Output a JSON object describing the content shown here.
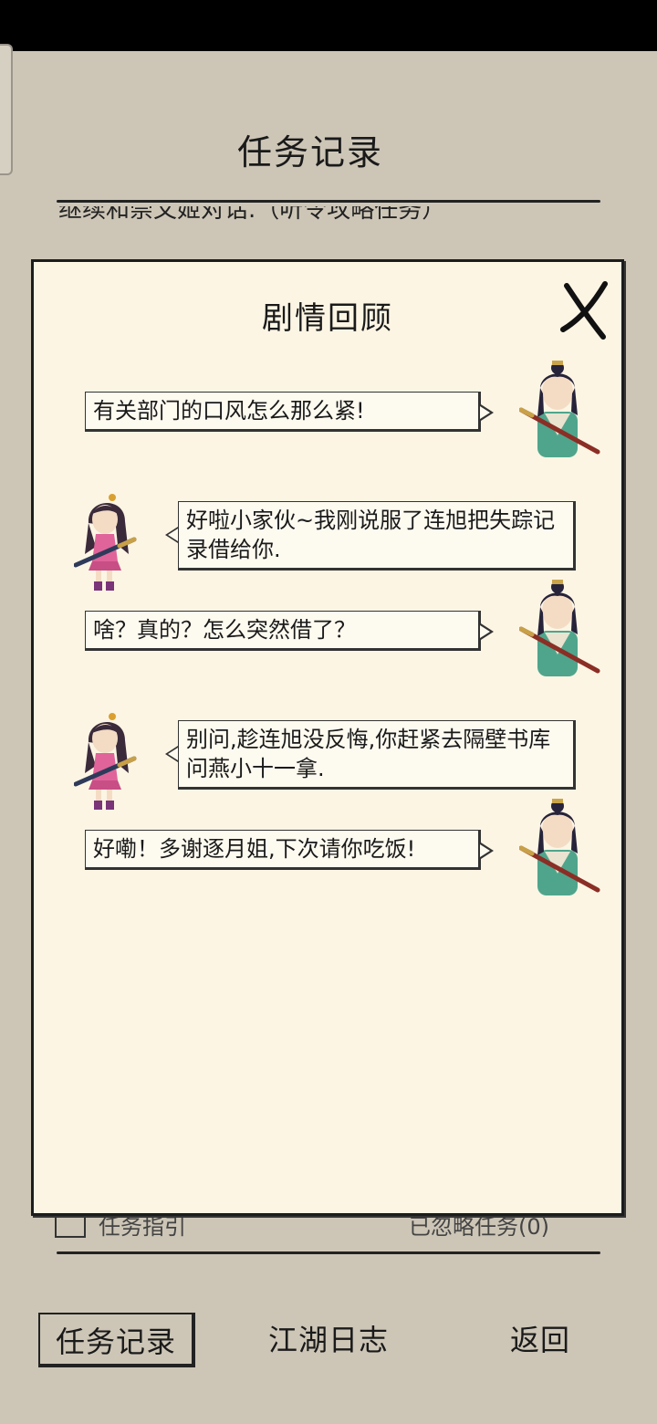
{
  "header": {
    "title": "任务记录"
  },
  "background_text": "继续和崇文姬对话.（听令攻略任务）",
  "dialog": {
    "title": "剧情回顾",
    "messages": [
      {
        "side": "right",
        "speaker": "male",
        "text": "有关部门的口风怎么那么紧!"
      },
      {
        "side": "left",
        "speaker": "female",
        "text": "好啦小家伙~我刚说服了连旭把失踪记录借给你."
      },
      {
        "side": "right",
        "speaker": "male",
        "text": "啥？真的？怎么突然借了？"
      },
      {
        "side": "left",
        "speaker": "female",
        "text": "别问,趁连旭没反悔,你赶紧去隔壁书库问燕小十一拿."
      },
      {
        "side": "right",
        "speaker": "male",
        "text": "好嘞！多谢逐月姐,下次请你吃饭!"
      }
    ]
  },
  "under_dialog": {
    "left_label": "任务指引",
    "right_label": "已忽略任务(0)"
  },
  "bottom_nav": [
    {
      "label": "任务记录",
      "active": true
    },
    {
      "label": "江湖日志",
      "active": false
    },
    {
      "label": "返回",
      "active": false
    }
  ]
}
